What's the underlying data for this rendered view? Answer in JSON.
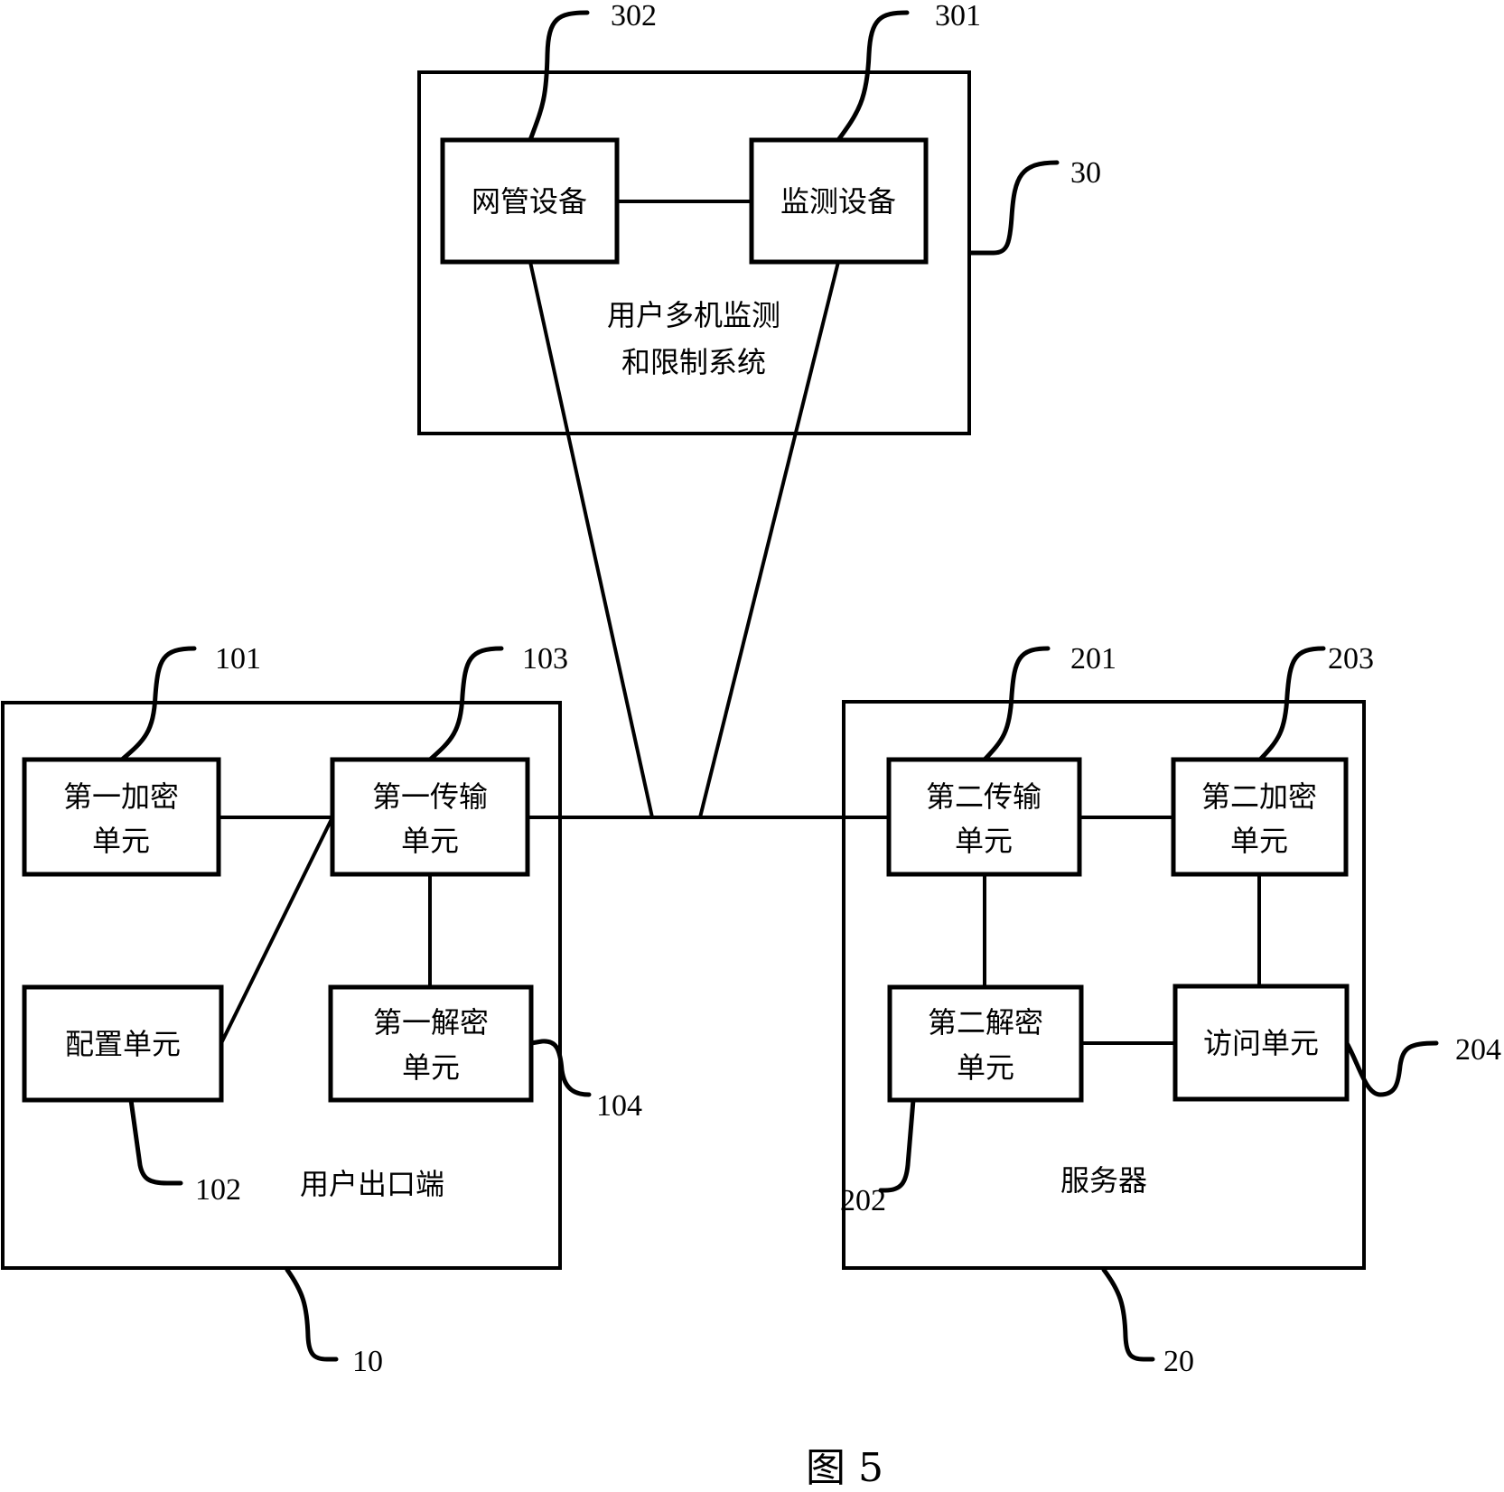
{
  "figure": {
    "caption": "图 5"
  },
  "system_30": {
    "ref": "30",
    "title_line1": "用户多机监测",
    "title_line2": "和限制系统",
    "nms_device": {
      "ref": "302",
      "label": "网管设备"
    },
    "monitor_device": {
      "ref": "301",
      "label": "监测设备"
    }
  },
  "client_10": {
    "ref": "10",
    "title": "用户出口端",
    "enc1": {
      "ref": "101",
      "line1": "第一加密",
      "line2": "单元"
    },
    "config": {
      "ref": "102",
      "label": "配置单元"
    },
    "trans1": {
      "ref": "103",
      "line1": "第一传输",
      "line2": "单元"
    },
    "dec1": {
      "ref": "104",
      "line1": "第一解密",
      "line2": "单元"
    }
  },
  "server_20": {
    "ref": "20",
    "title": "服务器",
    "trans2": {
      "ref": "201",
      "line1": "第二传输",
      "line2": "单元"
    },
    "dec2": {
      "ref": "202",
      "line1": "第二解密",
      "line2": "单元"
    },
    "enc2": {
      "ref": "203",
      "line1": "第二加密",
      "line2": "单元"
    },
    "access": {
      "ref": "204",
      "label": "访问单元"
    }
  }
}
